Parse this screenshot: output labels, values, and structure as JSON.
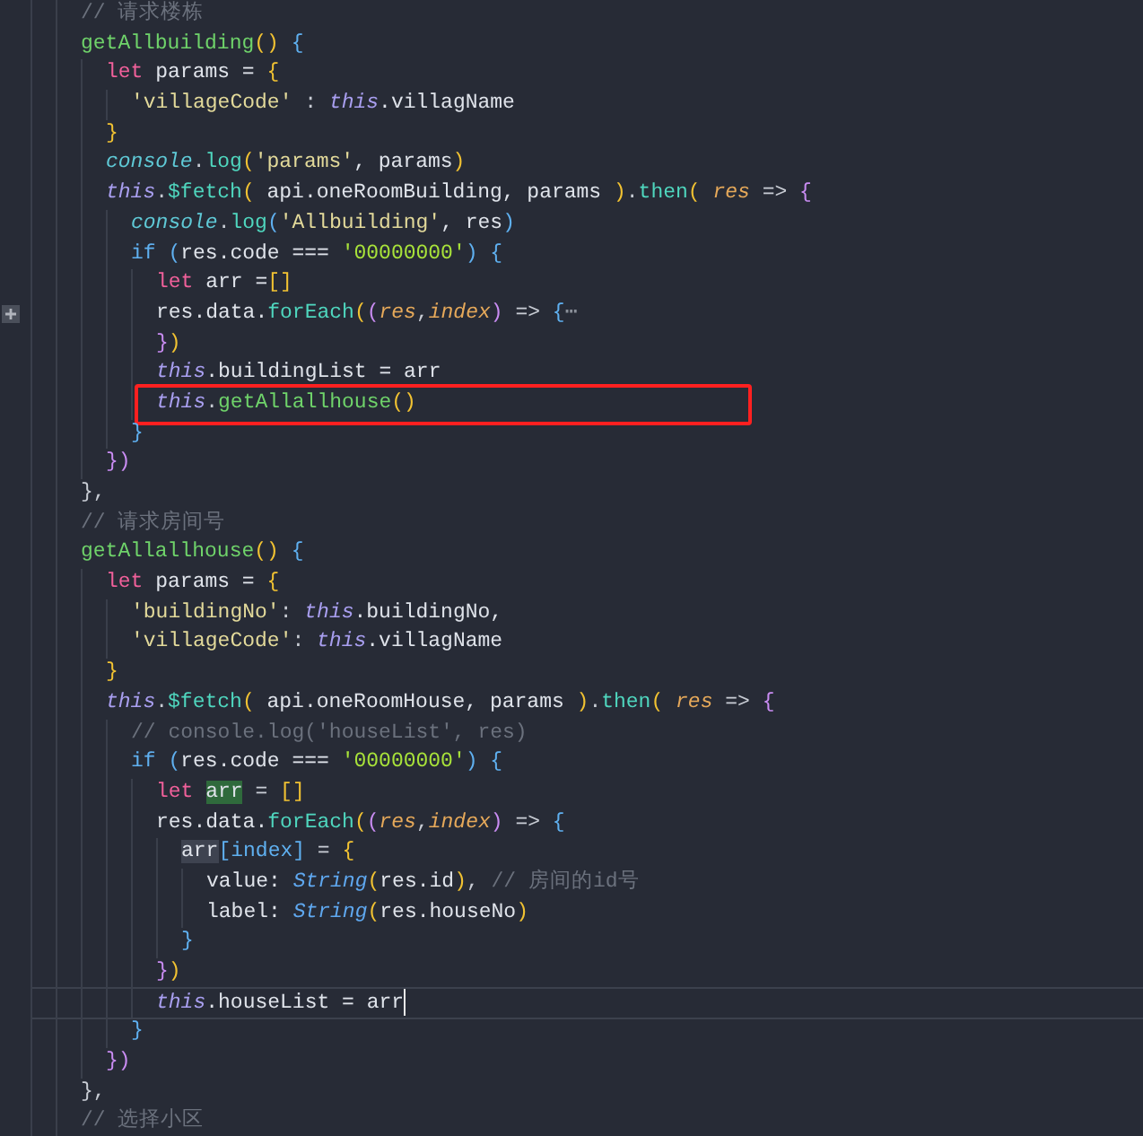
{
  "editor": {
    "lines": [
      {
        "tokens": [
          {
            "text": "// 请求楼栋",
            "kind": "comment"
          }
        ]
      },
      {
        "tokens": [
          {
            "text": "getAllbuilding",
            "kind": "function"
          },
          {
            "text": "()",
            "kind": "yellow"
          },
          {
            "text": " {",
            "kind": "blue"
          }
        ],
        "children": [
          {
            "tokens": [
              {
                "text": "let",
                "kind": "keyword"
              },
              {
                "text": " params = ",
                "kind": "plain"
              },
              {
                "text": "{",
                "kind": "yellow"
              }
            ],
            "children": [
              {
                "tokens": [
                  {
                    "text": "'villageCode'",
                    "kind": "string"
                  },
                  {
                    "text": " : ",
                    "kind": "punct"
                  },
                  {
                    "text": "this",
                    "kind": "this"
                  },
                  {
                    "text": ".villagName",
                    "kind": "plain"
                  }
                ]
              }
            ]
          },
          {
            "tokens": [
              {
                "text": "}",
                "kind": "yellow"
              }
            ]
          },
          {
            "tokens": [
              {
                "text": "console",
                "kind": "object"
              },
              {
                "text": ".",
                "kind": "punct"
              },
              {
                "text": "log",
                "kind": "method"
              },
              {
                "text": "(",
                "kind": "yellow"
              },
              {
                "text": "'params'",
                "kind": "string"
              },
              {
                "text": ", params",
                "kind": "plain"
              },
              {
                "text": ")",
                "kind": "yellow"
              }
            ]
          },
          {
            "tokens": [
              {
                "text": "this",
                "kind": "this"
              },
              {
                "text": ".",
                "kind": "punct"
              },
              {
                "text": "$fetch",
                "kind": "method"
              },
              {
                "text": "(",
                "kind": "yellow"
              },
              {
                "text": " api.oneRoomBuilding, params ",
                "kind": "plain"
              },
              {
                "text": ")",
                "kind": "yellow"
              },
              {
                "text": ".",
                "kind": "punct"
              },
              {
                "text": "then",
                "kind": "method"
              },
              {
                "text": "( ",
                "kind": "yellow"
              },
              {
                "text": "res",
                "kind": "param"
              },
              {
                "text": " => ",
                "kind": "punct"
              },
              {
                "text": "{",
                "kind": "magenta"
              }
            ],
            "children": [
              {
                "tokens": [
                  {
                    "text": "console",
                    "kind": "object"
                  },
                  {
                    "text": ".",
                    "kind": "punct"
                  },
                  {
                    "text": "log",
                    "kind": "method"
                  },
                  {
                    "text": "(",
                    "kind": "blue"
                  },
                  {
                    "text": "'Allbuilding'",
                    "kind": "string"
                  },
                  {
                    "text": ", res",
                    "kind": "plain"
                  },
                  {
                    "text": ")",
                    "kind": "blue"
                  }
                ]
              },
              {
                "tokens": [
                  {
                    "text": "if",
                    "kind": "control"
                  },
                  {
                    "text": " (",
                    "kind": "blue"
                  },
                  {
                    "text": "res.code === ",
                    "kind": "plain"
                  },
                  {
                    "text": "'00000000'",
                    "kind": "number"
                  },
                  {
                    "text": ") {",
                    "kind": "blue"
                  }
                ],
                "children": [
                  {
                    "tokens": [
                      {
                        "text": "let",
                        "kind": "keyword"
                      },
                      {
                        "text": " arr =",
                        "kind": "plain"
                      },
                      {
                        "text": "[]",
                        "kind": "yellow"
                      }
                    ]
                  },
                  {
                    "folded": true,
                    "tokens": [
                      {
                        "text": "res.data.",
                        "kind": "plain"
                      },
                      {
                        "text": "forEach",
                        "kind": "method"
                      },
                      {
                        "text": "(",
                        "kind": "yellow"
                      },
                      {
                        "text": "(",
                        "kind": "magenta"
                      },
                      {
                        "text": "res",
                        "kind": "param"
                      },
                      {
                        "text": ",",
                        "kind": "punct"
                      },
                      {
                        "text": "index",
                        "kind": "param"
                      },
                      {
                        "text": ")",
                        "kind": "magenta"
                      },
                      {
                        "text": " => ",
                        "kind": "punct"
                      },
                      {
                        "text": "{",
                        "kind": "blue"
                      },
                      {
                        "text": "⋯",
                        "kind": "fold"
                      }
                    ]
                  },
                  {
                    "tokens": [
                      {
                        "text": "}",
                        "kind": "magenta"
                      },
                      {
                        "text": ")",
                        "kind": "yellow"
                      }
                    ]
                  },
                  {
                    "tokens": [
                      {
                        "text": "this",
                        "kind": "this"
                      },
                      {
                        "text": ".buildingList = arr",
                        "kind": "plain"
                      }
                    ]
                  },
                  {
                    "annotated": true,
                    "tokens": [
                      {
                        "text": "this",
                        "kind": "this"
                      },
                      {
                        "text": ".",
                        "kind": "punct"
                      },
                      {
                        "text": "getAllallhouse",
                        "kind": "function"
                      },
                      {
                        "text": "()",
                        "kind": "yellow"
                      }
                    ]
                  }
                ]
              },
              {
                "tokens": [
                  {
                    "text": "}",
                    "kind": "blue"
                  }
                ]
              }
            ]
          },
          {
            "tokens": [
              {
                "text": "})",
                "kind": "magenta"
              }
            ]
          }
        ]
      },
      {
        "tokens": [
          {
            "text": "},",
            "kind": "punct"
          }
        ]
      },
      {
        "tokens": [
          {
            "text": "// 请求房间号",
            "kind": "comment"
          }
        ]
      },
      {
        "tokens": [
          {
            "text": "getAllallhouse",
            "kind": "function"
          },
          {
            "text": "()",
            "kind": "yellow"
          },
          {
            "text": " {",
            "kind": "blue"
          }
        ],
        "children": [
          {
            "tokens": [
              {
                "text": "let",
                "kind": "keyword"
              },
              {
                "text": " params = ",
                "kind": "plain"
              },
              {
                "text": "{",
                "kind": "yellow"
              }
            ],
            "children": [
              {
                "tokens": [
                  {
                    "text": "'buildingNo'",
                    "kind": "string"
                  },
                  {
                    "text": ": ",
                    "kind": "punct"
                  },
                  {
                    "text": "this",
                    "kind": "this"
                  },
                  {
                    "text": ".buildingNo,",
                    "kind": "plain"
                  }
                ]
              },
              {
                "tokens": [
                  {
                    "text": "'villageCode'",
                    "kind": "string"
                  },
                  {
                    "text": ": ",
                    "kind": "punct"
                  },
                  {
                    "text": "this",
                    "kind": "this"
                  },
                  {
                    "text": ".villagName",
                    "kind": "plain"
                  }
                ]
              }
            ]
          },
          {
            "tokens": [
              {
                "text": "}",
                "kind": "yellow"
              }
            ]
          },
          {
            "tokens": [
              {
                "text": "this",
                "kind": "this"
              },
              {
                "text": ".",
                "kind": "punct"
              },
              {
                "text": "$fetch",
                "kind": "method"
              },
              {
                "text": "(",
                "kind": "yellow"
              },
              {
                "text": " api.oneRoomHouse, params ",
                "kind": "plain"
              },
              {
                "text": ")",
                "kind": "yellow"
              },
              {
                "text": ".",
                "kind": "punct"
              },
              {
                "text": "then",
                "kind": "method"
              },
              {
                "text": "( ",
                "kind": "yellow"
              },
              {
                "text": "res",
                "kind": "param"
              },
              {
                "text": " => ",
                "kind": "punct"
              },
              {
                "text": "{",
                "kind": "magenta"
              }
            ],
            "children": [
              {
                "tokens": [
                  {
                    "text": "// console.log('houseList', res)",
                    "kind": "comment"
                  }
                ]
              },
              {
                "tokens": [
                  {
                    "text": "if",
                    "kind": "control"
                  },
                  {
                    "text": " (",
                    "kind": "blue"
                  },
                  {
                    "text": "res.code === ",
                    "kind": "plain"
                  },
                  {
                    "text": "'00000000'",
                    "kind": "number"
                  },
                  {
                    "text": ") {",
                    "kind": "blue"
                  }
                ],
                "children": [
                  {
                    "tokens": [
                      {
                        "text": "let ",
                        "kind": "keyword"
                      },
                      {
                        "text": "arr",
                        "kind": "plain",
                        "match_highlight": true
                      },
                      {
                        "text": " = ",
                        "kind": "punct"
                      },
                      {
                        "text": "[]",
                        "kind": "yellow"
                      }
                    ]
                  },
                  {
                    "tokens": [
                      {
                        "text": "res.data.",
                        "kind": "plain"
                      },
                      {
                        "text": "forEach",
                        "kind": "method"
                      },
                      {
                        "text": "(",
                        "kind": "yellow"
                      },
                      {
                        "text": "(",
                        "kind": "magenta"
                      },
                      {
                        "text": "res",
                        "kind": "param"
                      },
                      {
                        "text": ",",
                        "kind": "punct"
                      },
                      {
                        "text": "index",
                        "kind": "param"
                      },
                      {
                        "text": ")",
                        "kind": "magenta"
                      },
                      {
                        "text": " => ",
                        "kind": "punct"
                      },
                      {
                        "text": "{",
                        "kind": "blue"
                      }
                    ],
                    "children": [
                      {
                        "tokens": [
                          {
                            "text": "arr",
                            "kind": "plain",
                            "word_highlight": true
                          },
                          {
                            "text": "[index]",
                            "kind": "blue"
                          },
                          {
                            "text": " = ",
                            "kind": "punct"
                          },
                          {
                            "text": "{",
                            "kind": "yellow"
                          }
                        ],
                        "children": [
                          {
                            "tokens": [
                              {
                                "text": "value: ",
                                "kind": "plain"
                              },
                              {
                                "text": "String",
                                "kind": "type"
                              },
                              {
                                "text": "(",
                                "kind": "yellow"
                              },
                              {
                                "text": "res.id",
                                "kind": "plain"
                              },
                              {
                                "text": ")",
                                "kind": "yellow"
                              },
                              {
                                "text": ", ",
                                "kind": "punct"
                              },
                              {
                                "text": "// 房间的id号",
                                "kind": "comment"
                              }
                            ]
                          },
                          {
                            "tokens": [
                              {
                                "text": "label: ",
                                "kind": "plain"
                              },
                              {
                                "text": "String",
                                "kind": "type"
                              },
                              {
                                "text": "(",
                                "kind": "yellow"
                              },
                              {
                                "text": "res.houseNo",
                                "kind": "plain"
                              },
                              {
                                "text": ")",
                                "kind": "yellow"
                              }
                            ]
                          }
                        ]
                      },
                      {
                        "tokens": [
                          {
                            "text": "}",
                            "kind": "blue"
                          }
                        ]
                      }
                    ]
                  },
                  {
                    "tokens": [
                      {
                        "text": "}",
                        "kind": "magenta"
                      },
                      {
                        "text": ")",
                        "kind": "yellow"
                      }
                    ]
                  },
                  {
                    "current": true,
                    "tokens": [
                      {
                        "text": "this",
                        "kind": "this"
                      },
                      {
                        "text": ".houseList = arr",
                        "kind": "plain"
                      }
                    ]
                  }
                ]
              },
              {
                "tokens": [
                  {
                    "text": "}",
                    "kind": "blue"
                  }
                ]
              }
            ]
          },
          {
            "tokens": [
              {
                "text": "})",
                "kind": "magenta"
              }
            ]
          }
        ]
      },
      {
        "tokens": [
          {
            "text": "},",
            "kind": "punct"
          }
        ]
      },
      {
        "tokens": [
          {
            "text": "// 选择小区",
            "kind": "comment"
          }
        ]
      }
    ]
  }
}
